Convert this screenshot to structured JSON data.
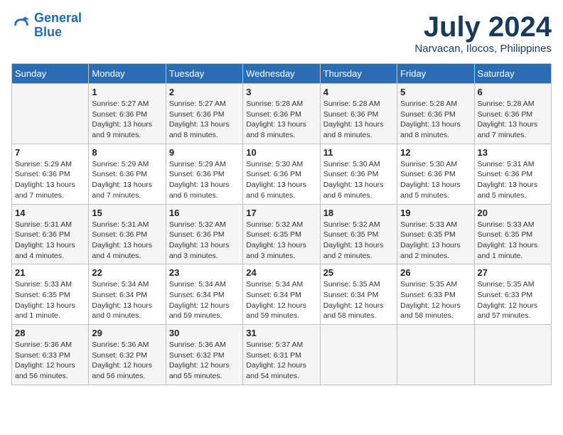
{
  "header": {
    "logo_line1": "General",
    "logo_line2": "Blue",
    "month": "July 2024",
    "location": "Narvacan, Ilocos, Philippines"
  },
  "weekdays": [
    "Sunday",
    "Monday",
    "Tuesday",
    "Wednesday",
    "Thursday",
    "Friday",
    "Saturday"
  ],
  "weeks": [
    [
      {
        "day": "",
        "info": ""
      },
      {
        "day": "1",
        "info": "Sunrise: 5:27 AM\nSunset: 6:36 PM\nDaylight: 13 hours\nand 9 minutes."
      },
      {
        "day": "2",
        "info": "Sunrise: 5:27 AM\nSunset: 6:36 PM\nDaylight: 13 hours\nand 8 minutes."
      },
      {
        "day": "3",
        "info": "Sunrise: 5:28 AM\nSunset: 6:36 PM\nDaylight: 13 hours\nand 8 minutes."
      },
      {
        "day": "4",
        "info": "Sunrise: 5:28 AM\nSunset: 6:36 PM\nDaylight: 13 hours\nand 8 minutes."
      },
      {
        "day": "5",
        "info": "Sunrise: 5:28 AM\nSunset: 6:36 PM\nDaylight: 13 hours\nand 8 minutes."
      },
      {
        "day": "6",
        "info": "Sunrise: 5:28 AM\nSunset: 6:36 PM\nDaylight: 13 hours\nand 7 minutes."
      }
    ],
    [
      {
        "day": "7",
        "info": "Sunrise: 5:29 AM\nSunset: 6:36 PM\nDaylight: 13 hours\nand 7 minutes."
      },
      {
        "day": "8",
        "info": "Sunrise: 5:29 AM\nSunset: 6:36 PM\nDaylight: 13 hours\nand 7 minutes."
      },
      {
        "day": "9",
        "info": "Sunrise: 5:29 AM\nSunset: 6:36 PM\nDaylight: 13 hours\nand 6 minutes."
      },
      {
        "day": "10",
        "info": "Sunrise: 5:30 AM\nSunset: 6:36 PM\nDaylight: 13 hours\nand 6 minutes."
      },
      {
        "day": "11",
        "info": "Sunrise: 5:30 AM\nSunset: 6:36 PM\nDaylight: 13 hours\nand 6 minutes."
      },
      {
        "day": "12",
        "info": "Sunrise: 5:30 AM\nSunset: 6:36 PM\nDaylight: 13 hours\nand 5 minutes."
      },
      {
        "day": "13",
        "info": "Sunrise: 5:31 AM\nSunset: 6:36 PM\nDaylight: 13 hours\nand 5 minutes."
      }
    ],
    [
      {
        "day": "14",
        "info": "Sunrise: 5:31 AM\nSunset: 6:36 PM\nDaylight: 13 hours\nand 4 minutes."
      },
      {
        "day": "15",
        "info": "Sunrise: 5:31 AM\nSunset: 6:36 PM\nDaylight: 13 hours\nand 4 minutes."
      },
      {
        "day": "16",
        "info": "Sunrise: 5:32 AM\nSunset: 6:36 PM\nDaylight: 13 hours\nand 3 minutes."
      },
      {
        "day": "17",
        "info": "Sunrise: 5:32 AM\nSunset: 6:35 PM\nDaylight: 13 hours\nand 3 minutes."
      },
      {
        "day": "18",
        "info": "Sunrise: 5:32 AM\nSunset: 6:35 PM\nDaylight: 13 hours\nand 2 minutes."
      },
      {
        "day": "19",
        "info": "Sunrise: 5:33 AM\nSunset: 6:35 PM\nDaylight: 13 hours\nand 2 minutes."
      },
      {
        "day": "20",
        "info": "Sunrise: 5:33 AM\nSunset: 6:35 PM\nDaylight: 13 hours\nand 1 minute."
      }
    ],
    [
      {
        "day": "21",
        "info": "Sunrise: 5:33 AM\nSunset: 6:35 PM\nDaylight: 13 hours\nand 1 minute."
      },
      {
        "day": "22",
        "info": "Sunrise: 5:34 AM\nSunset: 6:34 PM\nDaylight: 13 hours\nand 0 minutes."
      },
      {
        "day": "23",
        "info": "Sunrise: 5:34 AM\nSunset: 6:34 PM\nDaylight: 12 hours\nand 59 minutes."
      },
      {
        "day": "24",
        "info": "Sunrise: 5:34 AM\nSunset: 6:34 PM\nDaylight: 12 hours\nand 59 minutes."
      },
      {
        "day": "25",
        "info": "Sunrise: 5:35 AM\nSunset: 6:34 PM\nDaylight: 12 hours\nand 58 minutes."
      },
      {
        "day": "26",
        "info": "Sunrise: 5:35 AM\nSunset: 6:33 PM\nDaylight: 12 hours\nand 58 minutes."
      },
      {
        "day": "27",
        "info": "Sunrise: 5:35 AM\nSunset: 6:33 PM\nDaylight: 12 hours\nand 57 minutes."
      }
    ],
    [
      {
        "day": "28",
        "info": "Sunrise: 5:36 AM\nSunset: 6:33 PM\nDaylight: 12 hours\nand 56 minutes."
      },
      {
        "day": "29",
        "info": "Sunrise: 5:36 AM\nSunset: 6:32 PM\nDaylight: 12 hours\nand 56 minutes."
      },
      {
        "day": "30",
        "info": "Sunrise: 5:36 AM\nSunset: 6:32 PM\nDaylight: 12 hours\nand 55 minutes."
      },
      {
        "day": "31",
        "info": "Sunrise: 5:37 AM\nSunset: 6:31 PM\nDaylight: 12 hours\nand 54 minutes."
      },
      {
        "day": "",
        "info": ""
      },
      {
        "day": "",
        "info": ""
      },
      {
        "day": "",
        "info": ""
      }
    ]
  ]
}
